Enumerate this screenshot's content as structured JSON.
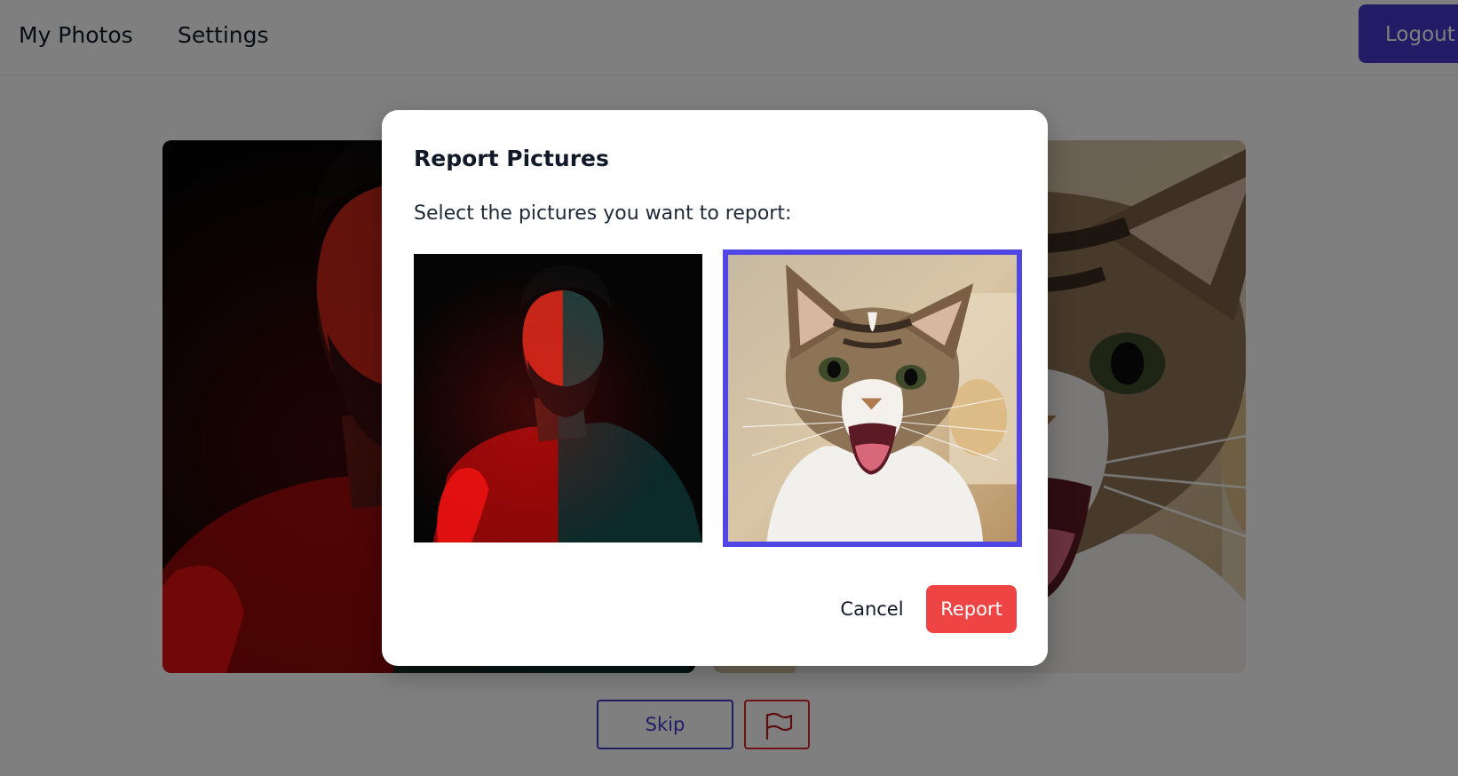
{
  "navbar": {
    "links": [
      {
        "label": "My Photos",
        "icon": null
      },
      {
        "label": "Settings",
        "icon": null
      }
    ],
    "logout_label": "Logout"
  },
  "photos": [
    {
      "subject": "man-portrait-red-teal-light"
    },
    {
      "subject": "cat-meowing"
    }
  ],
  "controls": {
    "skip_label": "Skip",
    "flag_icon": "flag-icon"
  },
  "modal": {
    "title": "Report Pictures",
    "prompt": "Select the pictures you want to report:",
    "options": [
      {
        "subject": "man-portrait-red-teal-light",
        "selected": false
      },
      {
        "subject": "cat-meowing",
        "selected": true
      }
    ],
    "cancel_label": "Cancel",
    "report_label": "Report"
  },
  "colors": {
    "primary": "#4338ca",
    "selection_border": "#4f46e5",
    "danger": "#ef4444",
    "flag_border": "#dc2626",
    "overlay": "rgba(0,0,0,0.5)"
  }
}
